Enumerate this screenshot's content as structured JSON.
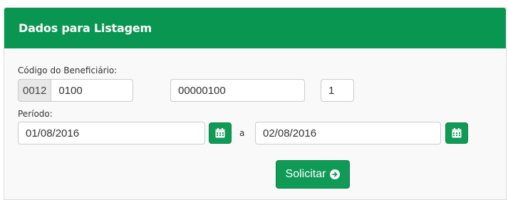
{
  "panel": {
    "title": "Dados para Listagem"
  },
  "beneficiario": {
    "label": "Código do Beneficiário:",
    "prefix": "0012",
    "part1": "0100",
    "part2": "00000100",
    "part3": "1"
  },
  "periodo": {
    "label": "Período:",
    "start": "01/08/2016",
    "separator": "a",
    "end": "02/08/2016"
  },
  "actions": {
    "submit_label": "Solicitar"
  },
  "colors": {
    "accent": "#099650",
    "button": "#0f9a55"
  },
  "icons": {
    "calendar": "calendar-icon",
    "arrow": "arrow-circle-right-icon"
  }
}
